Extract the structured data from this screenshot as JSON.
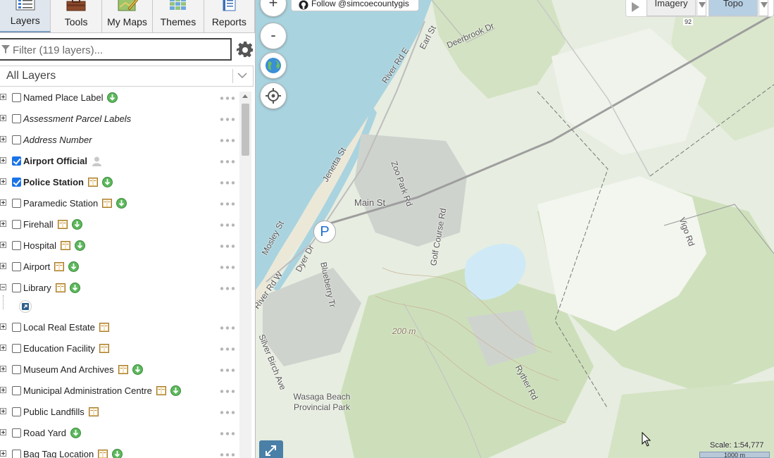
{
  "tabs": [
    {
      "label": "Layers",
      "icon": "layers-icon",
      "active": true
    },
    {
      "label": "Tools",
      "icon": "toolbox-icon"
    },
    {
      "label": "My Maps",
      "icon": "map-pencil-icon"
    },
    {
      "label": "Themes",
      "icon": "themes-grid-icon"
    },
    {
      "label": "Reports",
      "icon": "report-notebook-icon"
    }
  ],
  "filter": {
    "placeholder": "Filter (119 layers)...",
    "value": ""
  },
  "layer_select": {
    "value": "All Layers"
  },
  "layers": [
    {
      "label": "Named Place Label",
      "checked": false,
      "style": "normal",
      "icons": [
        "download-icon"
      ]
    },
    {
      "label": "Assessment Parcel Labels",
      "checked": false,
      "style": "italic",
      "icons": []
    },
    {
      "label": "Address Number",
      "checked": false,
      "style": "italic",
      "icons": []
    },
    {
      "label": "Airport Official",
      "checked": true,
      "style": "bold",
      "icons": [
        "user-icon"
      ]
    },
    {
      "label": "Police Station",
      "checked": true,
      "style": "bold",
      "icons": [
        "metadata-icon",
        "download-icon"
      ]
    },
    {
      "label": "Paramedic Station",
      "checked": false,
      "style": "normal",
      "icons": [
        "metadata-icon",
        "download-icon"
      ]
    },
    {
      "label": "Firehall",
      "checked": false,
      "style": "normal",
      "icons": [
        "metadata-icon",
        "download-icon"
      ]
    },
    {
      "label": "Hospital",
      "checked": false,
      "style": "normal",
      "icons": [
        "metadata-icon",
        "download-icon"
      ]
    },
    {
      "label": "Airport",
      "checked": false,
      "style": "normal",
      "icons": [
        "metadata-icon",
        "download-icon"
      ]
    },
    {
      "label": "Library",
      "checked": false,
      "style": "normal",
      "icons": [
        "metadata-icon",
        "download-icon"
      ],
      "expanded": true
    },
    {
      "label": "Local Real Estate",
      "checked": false,
      "style": "normal",
      "icons": [
        "metadata-icon"
      ]
    },
    {
      "label": "Education Facility",
      "checked": false,
      "style": "normal",
      "icons": [
        "metadata-icon"
      ]
    },
    {
      "label": "Museum And Archives",
      "checked": false,
      "style": "normal",
      "icons": [
        "metadata-icon",
        "download-icon"
      ]
    },
    {
      "label": "Municipal Administration Centre",
      "checked": false,
      "style": "normal",
      "icons": [
        "metadata-icon",
        "download-icon"
      ]
    },
    {
      "label": "Public Landfills",
      "checked": false,
      "style": "normal",
      "icons": [
        "metadata-icon"
      ]
    },
    {
      "label": "Road Yard",
      "checked": false,
      "style": "normal",
      "icons": [
        "download-icon"
      ]
    },
    {
      "label": "Bag Tag Location",
      "checked": false,
      "style": "normal",
      "icons": [
        "metadata-icon",
        "download-icon"
      ]
    }
  ],
  "map": {
    "zoom_in": "+",
    "zoom_out": "-",
    "follow_label": "Follow @simcoecountygis",
    "basemaps": {
      "imagery": "Imagery",
      "topo": "Topo",
      "selected": "Topo"
    },
    "poi_letter": "P",
    "scale_text": "Scale: 1:54,777",
    "scale_bar_label": "1000 m",
    "labels": {
      "river_rd": "River Rd E",
      "earl_st": "Earl St",
      "deerbrook": "Deerbrook Dr",
      "jenetta": "Jenetta St",
      "zoo_park": "Zoo Park Rd",
      "main_st": "Main St",
      "vigo": "Vigo Rd",
      "mosley": "Mosley St",
      "dyer": "Dyer Dr",
      "blueberry": "Blueberry Tr",
      "golf_course": "Golf Course Rd",
      "river_rd_w": "River Rd W",
      "birch": "Silver Birch Ave",
      "elev": "200 m",
      "ryther": "Ryther Rd",
      "park": "Wasaga Beach Provincial Park",
      "road_sign": "92"
    }
  },
  "colors": {
    "accent": "#1a73e8",
    "water": "#a9d3df",
    "forest": "#c9dcb4",
    "download": "#5cb85c"
  }
}
